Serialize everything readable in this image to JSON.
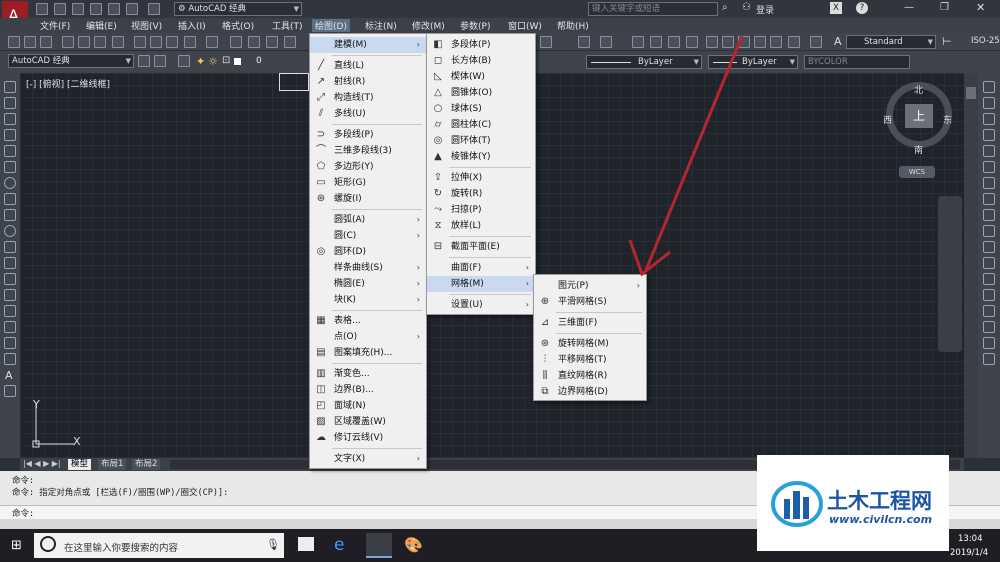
{
  "title_bar": {
    "workspace": "AutoCAD 经典",
    "search_placeholder": "键入关键字或短语",
    "login": "登录"
  },
  "menubar": [
    "文件(F)",
    "编辑(E)",
    "视图(V)",
    "插入(I)",
    "格式(O)",
    "工具(T)",
    "绘图(D)",
    "标注(N)",
    "修改(M)",
    "参数(P)",
    "窗口(W)",
    "帮助(H)"
  ],
  "toolbar2": {
    "workspace_combo": "AutoCAD 经典",
    "layer_value": "0",
    "linetype1": "ByLayer",
    "linetype2": "ByLayer",
    "lineweight": "BYCOLOR",
    "text_style": "Standard",
    "dim_style": "ISO-25"
  },
  "viewport": {
    "label": "[-] [俯视] [二维线框]",
    "compass": {
      "north": "北",
      "south": "南",
      "east": "东",
      "west": "西",
      "top": "上"
    },
    "wcs": "WCS",
    "ucs_y": "Y",
    "ucs_x": "X"
  },
  "tabs": [
    "模型",
    "布局1",
    "布局2"
  ],
  "command": {
    "line1": "命令:",
    "line2": "命令: 指定对角点或 [栏选(F)/圈围(WP)/圈交(CP)]:",
    "prompt": "命令:"
  },
  "draw_menu": [
    {
      "label": "建模(M)",
      "sub": true,
      "icon": "",
      "hl": true
    },
    {
      "sep": true
    },
    {
      "label": "直线(L)",
      "icon": "line-icon",
      "glyph": "╱"
    },
    {
      "label": "射线(R)",
      "icon": "ray-icon",
      "glyph": "↗"
    },
    {
      "label": "构造线(T)",
      "icon": "xline-icon",
      "glyph": "⤢"
    },
    {
      "label": "多线(U)",
      "icon": "mline-icon",
      "glyph": "⫽"
    },
    {
      "sep": true
    },
    {
      "label": "多段线(P)",
      "icon": "polyline-icon",
      "glyph": "⊃"
    },
    {
      "label": "三维多段线(3)",
      "icon": "3dpoly-icon",
      "glyph": "⌒"
    },
    {
      "label": "多边形(Y)",
      "icon": "polygon-icon",
      "glyph": "⬠"
    },
    {
      "label": "矩形(G)",
      "icon": "rectangle-icon",
      "glyph": "▭"
    },
    {
      "label": "螺旋(I)",
      "icon": "helix-icon",
      "glyph": "⊛"
    },
    {
      "sep": true
    },
    {
      "label": "圆弧(A)",
      "sub": true
    },
    {
      "label": "圆(C)",
      "sub": true
    },
    {
      "label": "圆环(D)",
      "icon": "donut-icon",
      "glyph": "◎"
    },
    {
      "label": "样条曲线(S)",
      "sub": true
    },
    {
      "label": "椭圆(E)",
      "sub": true
    },
    {
      "label": "块(K)",
      "sub": true
    },
    {
      "sep": true
    },
    {
      "label": "表格...",
      "icon": "table-icon",
      "glyph": "▦"
    },
    {
      "label": "点(O)",
      "sub": true
    },
    {
      "label": "图案填充(H)...",
      "icon": "hatch-icon",
      "glyph": "▤"
    },
    {
      "sep": true
    },
    {
      "label": "渐变色...",
      "icon": "gradient-icon",
      "glyph": "▥"
    },
    {
      "label": "边界(B)...",
      "icon": "boundary-icon",
      "glyph": "◫"
    },
    {
      "label": "面域(N)",
      "icon": "region-icon",
      "glyph": "◰"
    },
    {
      "label": "区域覆盖(W)",
      "icon": "wipeout-icon",
      "glyph": "▨"
    },
    {
      "label": "修订云线(V)",
      "icon": "revcloud-icon",
      "glyph": "☁"
    },
    {
      "sep": true
    },
    {
      "label": "文字(X)",
      "sub": true
    }
  ],
  "modeling_menu": [
    {
      "label": "多段体(P)",
      "icon": "polysolid-icon",
      "glyph": "◧"
    },
    {
      "label": "长方体(B)",
      "icon": "box-icon",
      "glyph": "◻"
    },
    {
      "label": "楔体(W)",
      "icon": "wedge-icon",
      "glyph": "◺"
    },
    {
      "label": "圆锥体(O)",
      "icon": "cone-icon",
      "glyph": "△"
    },
    {
      "label": "球体(S)",
      "icon": "sphere-icon",
      "glyph": "○"
    },
    {
      "label": "圆柱体(C)",
      "icon": "cylinder-icon",
      "glyph": "⌭"
    },
    {
      "label": "圆环体(T)",
      "icon": "torus-icon",
      "glyph": "◎"
    },
    {
      "label": "棱锥体(Y)",
      "icon": "pyramid-icon",
      "glyph": "▲"
    },
    {
      "sep": true
    },
    {
      "label": "拉伸(X)",
      "icon": "extrude-icon",
      "glyph": "⇪"
    },
    {
      "label": "旋转(R)",
      "icon": "revolve-icon",
      "glyph": "↻"
    },
    {
      "label": "扫掠(P)",
      "icon": "sweep-icon",
      "glyph": "⤳"
    },
    {
      "label": "放样(L)",
      "icon": "loft-icon",
      "glyph": "⧖"
    },
    {
      "sep": true
    },
    {
      "label": "截面平面(E)",
      "icon": "sectionplane-icon",
      "glyph": "⊟"
    },
    {
      "sep": true
    },
    {
      "label": "曲面(F)",
      "sub": true
    },
    {
      "label": "网格(M)",
      "sub": true,
      "hl": true
    },
    {
      "sep": true
    },
    {
      "label": "设置(U)",
      "sub": true
    }
  ],
  "mesh_menu": [
    {
      "label": "图元(P)",
      "sub": true
    },
    {
      "label": "平滑网格(S)",
      "icon": "smoothmesh-icon",
      "glyph": "⊕"
    },
    {
      "sep": true
    },
    {
      "label": "三维面(F)",
      "icon": "3dface-icon",
      "glyph": "⊿"
    },
    {
      "sep": true
    },
    {
      "label": "旋转网格(M)",
      "icon": "revsurf-icon",
      "glyph": "⊛"
    },
    {
      "label": "平移网格(T)",
      "icon": "tabsurf-icon",
      "glyph": "⫶"
    },
    {
      "label": "直纹网格(R)",
      "icon": "rulesurf-icon",
      "glyph": "⫼"
    },
    {
      "label": "边界网格(D)",
      "icon": "edgesurf-icon",
      "glyph": "⧉"
    }
  ],
  "taskbar": {
    "search_placeholder": "在这里输入你要搜索的内容",
    "time": "13:04",
    "date": "2019/1/4"
  },
  "watermark": {
    "brand": "土木工程网",
    "url": "www.civilcn.com"
  },
  "colors": {
    "arrow": "#b5262f",
    "menu_highlight": "#c8d9f0",
    "canvas": "#1f232a"
  }
}
